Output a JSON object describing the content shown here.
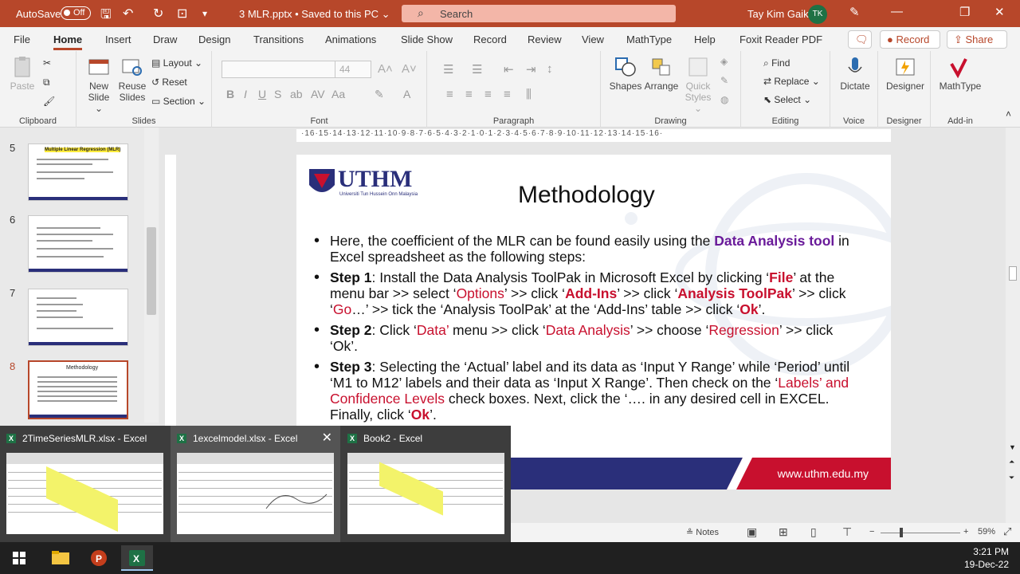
{
  "titlebar": {
    "autosave_label": "AutoSave",
    "autosave_state": "Off",
    "doc_title": "3 MLR.pptx • Saved to this PC ⌄",
    "search_placeholder": "Search",
    "user_name": "Tay Kim Gaik",
    "user_initials": "TK"
  },
  "menu": {
    "tabs": [
      "File",
      "Home",
      "Insert",
      "Draw",
      "Design",
      "Transitions",
      "Animations",
      "Slide Show",
      "Record",
      "Review",
      "View",
      "MathType",
      "Help",
      "Foxit Reader PDF"
    ],
    "active": "Home",
    "record_button": "Record",
    "share_button": "Share"
  },
  "ribbon": {
    "clipboard": {
      "label": "Clipboard",
      "paste": "Paste"
    },
    "slides": {
      "label": "Slides",
      "new_slide": "New Slide",
      "new_slide_l1": "New",
      "new_slide_l2": "Slide ⌄",
      "reuse_l1": "Reuse",
      "reuse_l2": "Slides",
      "layout": "Layout ⌄",
      "reset": "Reset",
      "section": "Section ⌄"
    },
    "font": {
      "label": "Font",
      "size": "44"
    },
    "paragraph": {
      "label": "Paragraph"
    },
    "drawing": {
      "label": "Drawing",
      "shapes": "Shapes",
      "arrange": "Arrange",
      "quick_l1": "Quick",
      "quick_l2": "Styles ⌄"
    },
    "editing": {
      "label": "Editing",
      "find": "Find",
      "replace": "Replace ⌄",
      "select": "Select ⌄"
    },
    "voice": {
      "label": "Voice",
      "dictate": "Dictate"
    },
    "designer": {
      "label": "Designer",
      "designer": "Designer"
    },
    "addin": {
      "label": "Add-in",
      "mathtype": "MathType"
    }
  },
  "thumbnails": [
    {
      "num": "5",
      "title": "Multiple Linear Regression (MLR)"
    },
    {
      "num": "6",
      "title": ""
    },
    {
      "num": "7",
      "title": ""
    },
    {
      "num": "8",
      "title": "Methodology",
      "selected": true
    }
  ],
  "ruler": {
    "h": "·16·15·14·13·12·11·10·9·8·7·6·5·4·3·2·1·0·1·2·3·4·5·6·7·8·9·10·11·12·13·14·15·16·"
  },
  "slide": {
    "logo_text": "UTHM",
    "logo_sub": "Universiti Tun Hussein Onn Malaysia",
    "title": "Methodology",
    "p1_a": "Here, the coefficient of the MLR can be found easily using the ",
    "p1_b": "Data Analysis tool",
    "p1_c": " in Excel spreadsheet as the following steps:",
    "s1_lbl": "Step 1",
    "s1_a": ":      Install the Data Analysis ToolPak in Microsoft Excel by clicking ‘",
    "s1_file": "File",
    "s1_b": "’ at the menu bar >> select ‘",
    "s1_options": "Options",
    "s1_c": "’ >> click ‘",
    "s1_addins": "Add-Ins",
    "s1_d": "’ >> click ‘",
    "s1_atp": "Analysis ToolPak",
    "s1_e": "’ >> click ‘",
    "s1_go": "Go",
    "s1_f": "…’ >> tick the ‘Analysis ToolPak’ at the ‘Add-Ins’ table >> click ‘",
    "s1_ok": "Ok",
    "s1_g": "’.",
    "s2_lbl": "Step 2",
    "s2_a": ": Click ‘",
    "s2_data": "Data’",
    "s2_b": " menu >> click ‘",
    "s2_da": "Data Analysis",
    "s2_c": "’ >> choose ‘",
    "s2_reg": "Regression",
    "s2_d": "’ >> click ‘Ok’.",
    "s3_lbl": "Step 3",
    "s3_a": ": Selecting the ‘Actual’ label and its data as ‘Input Y Range’ while ‘Period’ until ‘M1 to M12’ labels and their data as ‘Input X Range’. Then check on the ‘",
    "s3_lc": "Labels’ and Confidence Levels",
    "s3_b": " check boxes.  Next, click the ‘",
    "s3_c": "…. in any desired cell in EXCEL. Finally, click ‘",
    "s3_ok": "Ok",
    "s3_d": "’.",
    "url": "www.uthm.edu.my"
  },
  "taskpreview": [
    {
      "label": "2TimeSeriesMLR.xlsx - Excel"
    },
    {
      "label": "1excelmodel.xlsx - Excel"
    },
    {
      "label": "Book2 - Excel"
    }
  ],
  "statusbar": {
    "notes": "Notes",
    "zoom": "59%"
  },
  "clock": {
    "time": "3:21 PM",
    "date": "19-Dec-22"
  },
  "colors": {
    "accent": "#b7472a",
    "uthm_blue": "#2a2f7a",
    "uthm_red": "#c8102e",
    "highlight_purple": "#6a1b9a"
  }
}
